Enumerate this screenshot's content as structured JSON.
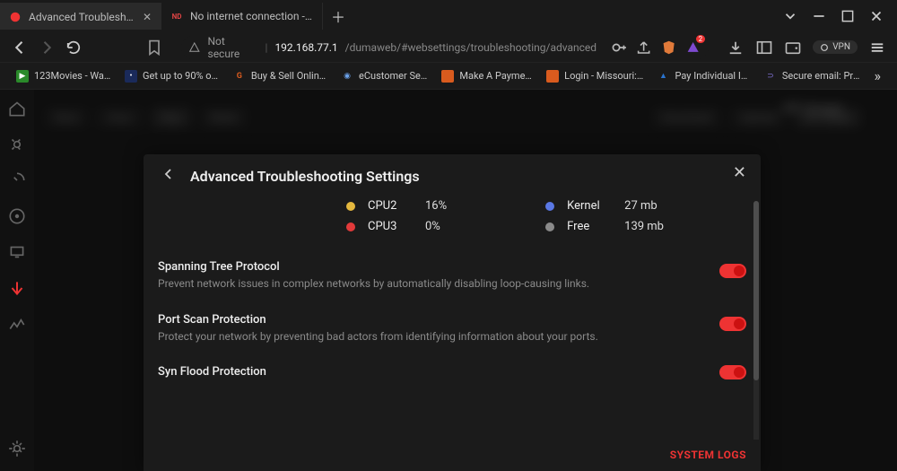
{
  "browser": {
    "tabs": [
      {
        "title": "Advanced Troubleshooting Settin",
        "active": true
      },
      {
        "title": "No internet connection - Netduma R",
        "prefix": "ND",
        "active": false
      }
    ],
    "address": {
      "secure_label": "Not secure",
      "host": "192.168.77.1",
      "path": "/dumaweb/#websettings/troubleshooting/advanced"
    },
    "vpn_label": "VPN",
    "bookmarks": [
      {
        "label": "123Movies - Watch...",
        "color": "#2a8a2a"
      },
      {
        "label": "Get up to 90% off b...",
        "color": "#5a3db5"
      },
      {
        "label": "Buy & Sell Online: P...",
        "color": "#d95b1e",
        "glyph": "G"
      },
      {
        "label": "eCustomer Service",
        "color": "#2a74d0",
        "glyph": "◐"
      },
      {
        "label": "Make A Payment -...",
        "color": "#d95b1e"
      },
      {
        "label": "Login - Missouri: Re...",
        "color": "#d95b1e"
      },
      {
        "label": "Pay Individual Inco...",
        "color": "#2a74d0"
      },
      {
        "label": "Secure email: Proto...",
        "color": "#6e5bd6"
      }
    ]
  },
  "modal": {
    "title": "Advanced Troubleshooting Settings",
    "cpu": [
      {
        "label": "CPU2",
        "value": "16%",
        "color": "#e5b83e"
      },
      {
        "label": "CPU3",
        "value": "0%",
        "color": "#e23a3a"
      }
    ],
    "mem": [
      {
        "label": "Kernel",
        "value": "27 mb",
        "color": "#5a78e5"
      },
      {
        "label": "Free",
        "value": "139 mb",
        "color": "#8a8a8a"
      }
    ],
    "settings": [
      {
        "title": "Spanning Tree Protocol",
        "desc": "Prevent network issues in complex networks by automatically disabling loop-causing links.",
        "on": true
      },
      {
        "title": "Port Scan Protection",
        "desc": "Protect your network by preventing bad actors from identifying information about your ports.",
        "on": true
      },
      {
        "title": "Syn Flood Protection",
        "desc": "",
        "on": true
      }
    ],
    "system_logs_label": "SYSTEM LOGS"
  },
  "bg": {
    "heading": "All Usage",
    "chips": [
      "Now",
      "Hour",
      "Day",
      "Week"
    ],
    "chips2": [
      "Download",
      "Upload",
      "All Usage"
    ]
  }
}
